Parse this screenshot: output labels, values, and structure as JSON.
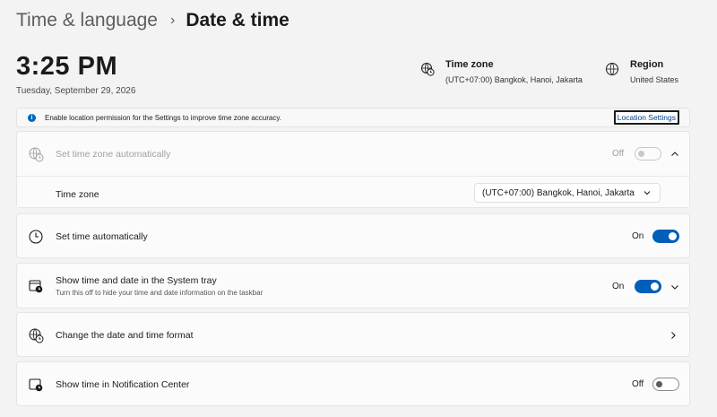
{
  "breadcrumb": {
    "parent": "Time & language",
    "separator": "›",
    "current": "Date & time"
  },
  "clock": {
    "time": "3:25 PM",
    "date": "Tuesday, September 29, 2026"
  },
  "timezone_info": {
    "title": "Time zone",
    "value": "(UTC+07:00) Bangkok, Hanoi, Jakarta",
    "icon": "globe-clock-icon"
  },
  "region_info": {
    "title": "Region",
    "value": "United States",
    "icon": "globe-icon"
  },
  "banner": {
    "text": "Enable location permission for the Settings to improve time zone accuracy.",
    "button_label": "Location Settings",
    "icon_glyph": "i"
  },
  "auto_timezone": {
    "label": "Set time zone automatically",
    "state": "Off",
    "sub_label": "Time zone",
    "dropdown_value": "(UTC+07:00) Bangkok, Hanoi, Jakarta"
  },
  "auto_time": {
    "label": "Set time automatically",
    "state": "On"
  },
  "system_tray": {
    "label": "Show time and date in the System tray",
    "description": "Turn this off to hide your time and date information on the taskbar",
    "state": "On"
  },
  "format": {
    "label": "Change the date and time format"
  },
  "notification_center": {
    "label": "Show time in Notification Center",
    "state": "Off"
  },
  "colors": {
    "accent": "#005fb8",
    "background": "#f3f3f3",
    "card": "#fbfbfb"
  }
}
